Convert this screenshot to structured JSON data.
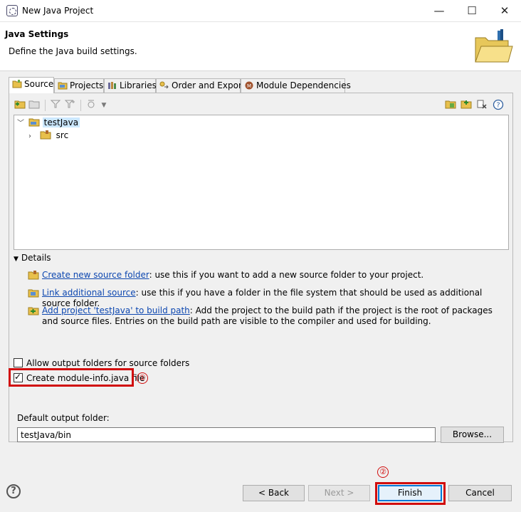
{
  "window": {
    "title": "New Java Project",
    "minimize": "—",
    "maximize": "☐",
    "close": "✕"
  },
  "header": {
    "title": "Java Settings",
    "description": "Define the Java build settings."
  },
  "tabs": [
    {
      "label": "Source",
      "active": true
    },
    {
      "label": "Projects"
    },
    {
      "label": "Libraries"
    },
    {
      "label": "Order and Export"
    },
    {
      "label": "Module Dependencies"
    }
  ],
  "tree": {
    "project": "testJava",
    "child": "src"
  },
  "details": {
    "heading": "Details",
    "items": [
      {
        "link": "Create new source folder",
        "text": ": use this if you want to add a new source folder to your project."
      },
      {
        "link": "Link additional source",
        "text": ": use this if you have a folder in the file system that should be used as additional source folder."
      },
      {
        "link": "Add project 'testJava' to build path",
        "text": ": Add the project to the build path if the project is the root of packages and source files. Entries on the build path are visible to the compiler and used for building."
      }
    ]
  },
  "options": {
    "allow_output": {
      "label": "Allow output folders for source folders",
      "checked": false
    },
    "module_info": {
      "label": "Create module-info.java file",
      "checked": true
    }
  },
  "output": {
    "label": "Default output folder:",
    "value": "testJava/bin",
    "browse": "Browse..."
  },
  "annotations": {
    "marker1": "①",
    "marker2": "②",
    "color": "#d10d0d"
  },
  "buttons": {
    "back": "< Back",
    "next": "Next >",
    "finish": "Finish",
    "cancel": "Cancel"
  }
}
